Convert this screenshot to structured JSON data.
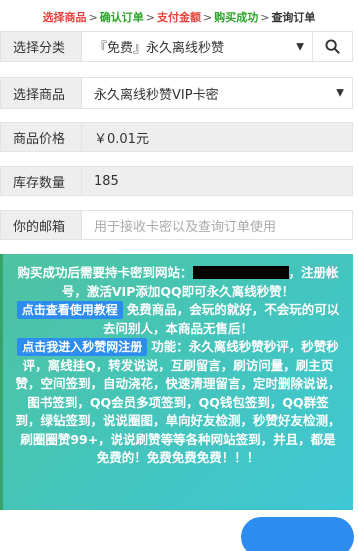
{
  "steps": [
    {
      "label": "选择商品",
      "color": "#e8433a"
    },
    {
      "label": "确认订单",
      "color": "#2aa52a"
    },
    {
      "label": "支付金额",
      "color": "#e8433a"
    },
    {
      "label": "购买成功",
      "color": "#2aa52a"
    },
    {
      "label": "查询订单",
      "color": "#333333"
    }
  ],
  "step_separator": ">",
  "form": {
    "category_label": "选择分类",
    "category_value": "『免费』永久离线秒赞",
    "product_label": "选择商品",
    "product_value": "永久离线秒赞VIP卡密",
    "price_label": "商品价格",
    "price_value": "￥0.01元",
    "stock_label": "库存数量",
    "stock_value": "185",
    "email_label": "你的邮箱",
    "email_placeholder": "用于接收卡密以及查询订单使用"
  },
  "icons": {
    "dropdown": "caret-down-icon",
    "search": "search-icon"
  },
  "notice": {
    "part1": "购买成功后需要持卡密到网站：",
    "part2": "，注册帐号，激活VIP添加QQ即可永久离线秒赞！",
    "tutorial_button": "点击查看使用教程",
    "part3": "免费商品，会玩的就好，不会玩的可以去问别人，本商品无售后！",
    "register_button": "点击我进入秒赞网注册",
    "part4": "功能：永久离线秒赞秒评，秒赞秒评，离线挂Q，转发说说，互刷留言，刷访问量，刷主页赞，空间签到，自动浇花，快速清理留言，定时删除说说，图书签到，QQ会员多项签到，QQ钱包签到，QQ群签到，绿钻签到，说说圈图，单向好友检测，秒赞好友检测，刷圈圈赞99+，说说刷赞等等各种网站签到，并且，都是免费的！免费免费免费！！！"
  },
  "colors": {
    "notice_gradient_start": "#4fc3a1",
    "notice_gradient_end": "#3fc7d6",
    "badge": "#2d8cf0"
  }
}
